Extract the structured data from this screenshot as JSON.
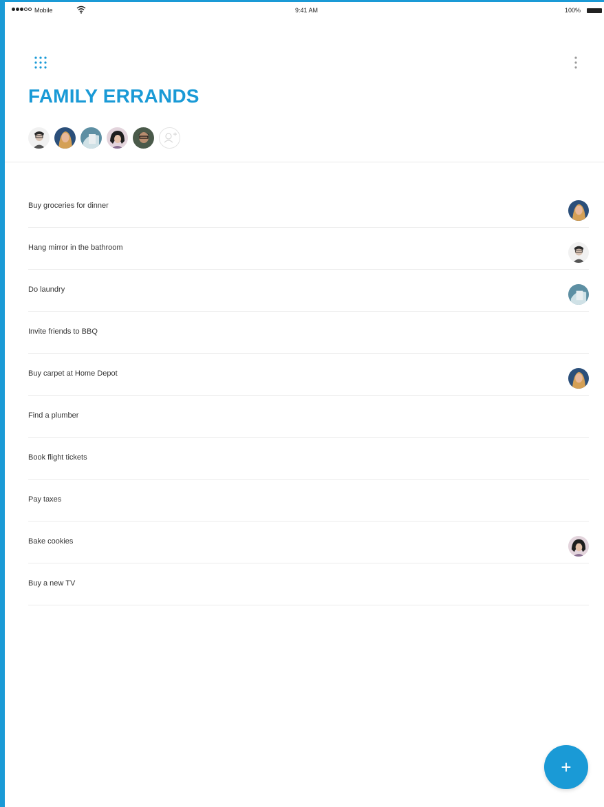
{
  "status_bar": {
    "carrier": "Mobile",
    "time": "9:41 AM",
    "battery": "100%"
  },
  "list": {
    "title": "FAMILY ERRANDS",
    "members": [
      "member-1",
      "member-2",
      "member-3",
      "member-4",
      "member-5"
    ]
  },
  "tasks": [
    {
      "label": "Buy groceries for dinner",
      "assignee": "member-2"
    },
    {
      "label": "Hang mirror in the bathroom",
      "assignee": "member-1"
    },
    {
      "label": "Do laundry",
      "assignee": "member-3"
    },
    {
      "label": "Invite friends to BBQ",
      "assignee": ""
    },
    {
      "label": "Buy carpet at Home Depot",
      "assignee": "member-2"
    },
    {
      "label": "Find a plumber",
      "assignee": ""
    },
    {
      "label": "Book flight tickets",
      "assignee": ""
    },
    {
      "label": "Pay taxes",
      "assignee": ""
    },
    {
      "label": "Bake cookies",
      "assignee": "member-4"
    },
    {
      "label": "Buy a new TV",
      "assignee": ""
    }
  ],
  "fab": {
    "label": "+"
  },
  "colors": {
    "accent": "#1a9ad6"
  },
  "icons": {
    "menu": "grid-icon",
    "more": "more-vertical-icon",
    "add_member": "add-member-icon",
    "fab": "plus-icon"
  }
}
